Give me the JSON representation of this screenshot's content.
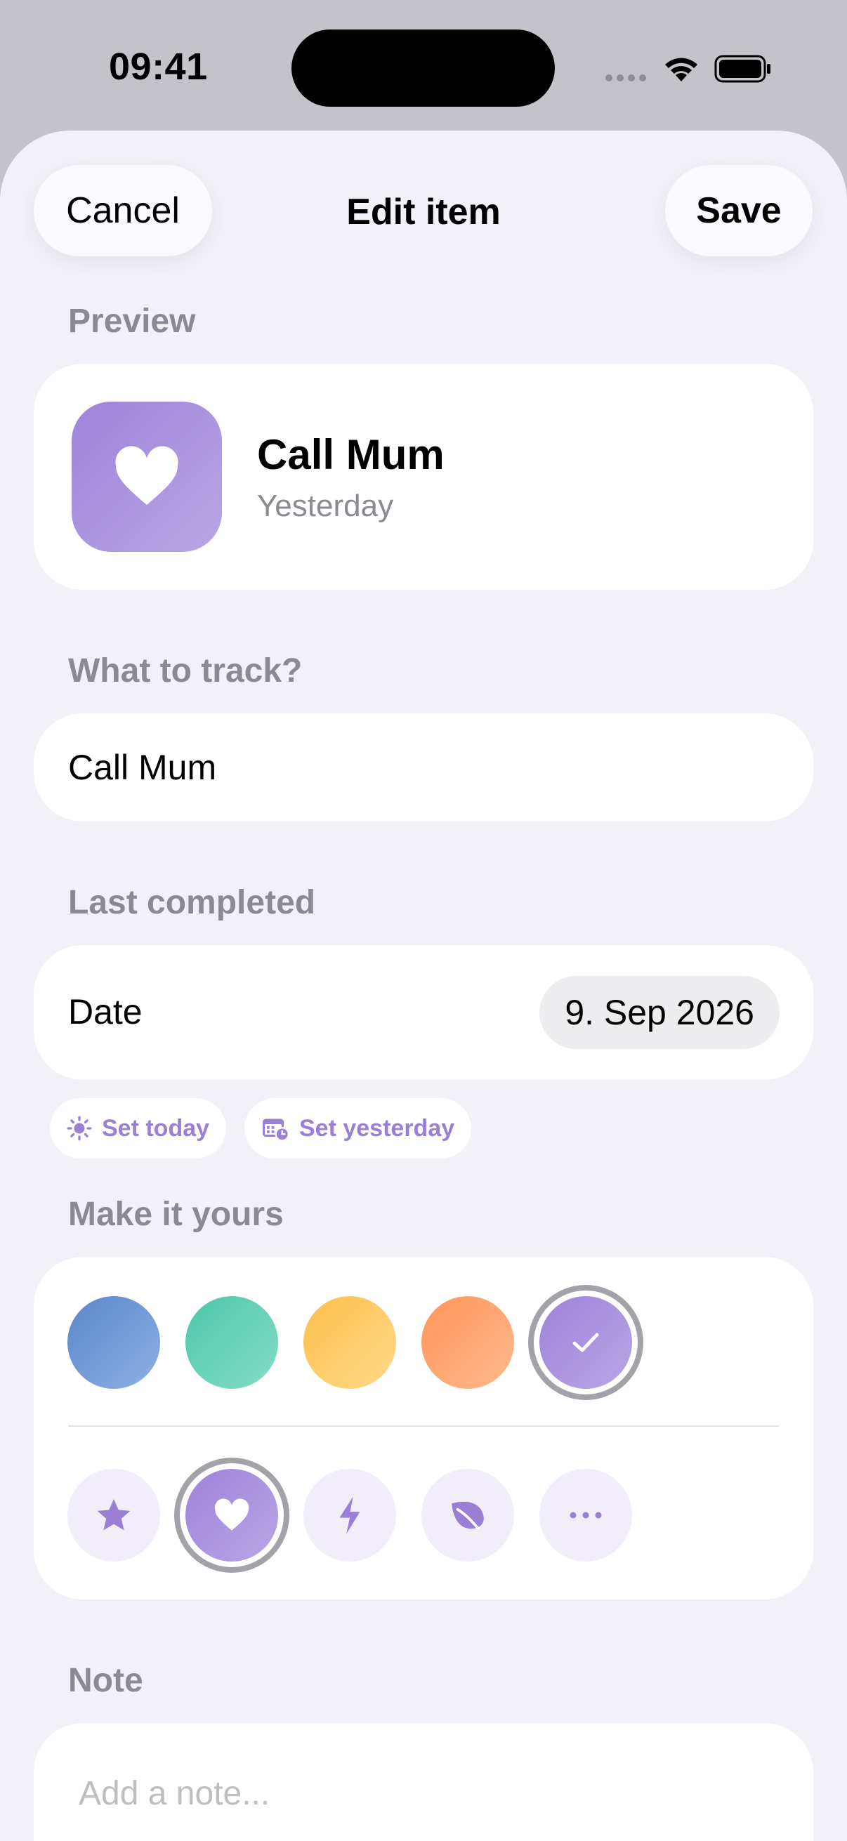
{
  "status_bar": {
    "time": "09:41"
  },
  "header": {
    "cancel_label": "Cancel",
    "title": "Edit item",
    "save_label": "Save"
  },
  "preview": {
    "section_label": "Preview",
    "name": "Call Mum",
    "subtitle": "Yesterday",
    "icon": "heart-icon"
  },
  "track": {
    "section_label": "What to track?",
    "value": "Call Mum"
  },
  "last_completed": {
    "section_label": "Last completed",
    "date_label": "Date",
    "date_value": "9. Sep 2026",
    "quick_actions": [
      {
        "label": "Set today",
        "icon": "sun-icon"
      },
      {
        "label": "Set yesterday",
        "icon": "calendar-clock-icon"
      }
    ]
  },
  "customize": {
    "section_label": "Make it yours",
    "colors": [
      {
        "name": "blue",
        "from": "#5a86cc",
        "to": "#8fb1e3",
        "selected": false
      },
      {
        "name": "teal",
        "from": "#4dc7a8",
        "to": "#86ddc6",
        "selected": false
      },
      {
        "name": "yellow",
        "from": "#fcbf4c",
        "to": "#ffd98a",
        "selected": false
      },
      {
        "name": "orange",
        "from": "#fd955a",
        "to": "#ffb98b",
        "selected": false
      },
      {
        "name": "purple",
        "from": "#9d83d9",
        "to": "#b8a7e6",
        "selected": true
      }
    ],
    "icons": [
      {
        "name": "star-icon",
        "selected": false
      },
      {
        "name": "heart-icon",
        "selected": true
      },
      {
        "name": "bolt-icon",
        "selected": false
      },
      {
        "name": "leaf-icon",
        "selected": false
      },
      {
        "name": "more-icon",
        "selected": false
      }
    ],
    "accent": "#9a80d4"
  },
  "note": {
    "section_label": "Note",
    "placeholder": "Add a note..."
  }
}
